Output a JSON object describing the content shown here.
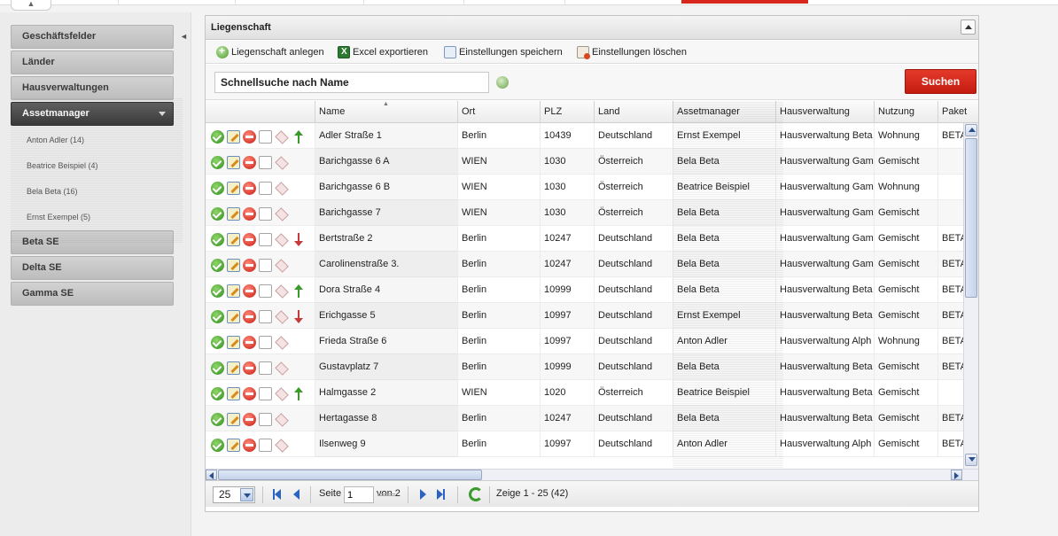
{
  "sidebar": {
    "items": [
      {
        "label": "Geschäftsfelder"
      },
      {
        "label": "Länder"
      },
      {
        "label": "Hausverwaltungen"
      },
      {
        "label": "Assetmanager"
      },
      {
        "label": "Beta SE"
      },
      {
        "label": "Delta SE"
      },
      {
        "label": "Gamma SE"
      }
    ],
    "subitems": [
      {
        "label": "Anton Adler (14)"
      },
      {
        "label": "Beatrice Beispiel (4)"
      },
      {
        "label": "Bela Beta (16)"
      },
      {
        "label": "Ernst Exempel (5)"
      }
    ]
  },
  "panel": {
    "title": "Liegenschaft"
  },
  "toolbar": {
    "add_label": "Liegenschaft anlegen",
    "excel_label": "Excel exportieren",
    "save_label": "Einstellungen speichern",
    "delete_label": "Einstellungen löschen"
  },
  "search": {
    "value": "Schnellsuche nach Name",
    "button": "Suchen"
  },
  "grid": {
    "columns": [
      "Name",
      "Ort",
      "PLZ",
      "Land",
      "Assetmanager",
      "Hausverwaltung",
      "Nutzung",
      "Paket"
    ],
    "rows": [
      {
        "name": "Adler Straße 1",
        "ort": "Berlin",
        "plz": "10439",
        "land": "Deutschland",
        "am": "Ernst Exempel",
        "hv": "Hausverwaltung Beta",
        "nutzung": "Wohnung",
        "paket": "BETA",
        "trend": "up"
      },
      {
        "name": "Barichgasse 6 A",
        "ort": "WIEN",
        "plz": "1030",
        "land": "Österreich",
        "am": "Bela Beta",
        "hv": "Hausverwaltung Gam",
        "nutzung": "Gemischt",
        "paket": "",
        "trend": ""
      },
      {
        "name": "Barichgasse 6 B",
        "ort": "WIEN",
        "plz": "1030",
        "land": "Österreich",
        "am": "Beatrice Beispiel",
        "hv": "Hausverwaltung Gam",
        "nutzung": "Wohnung",
        "paket": "",
        "trend": ""
      },
      {
        "name": "Barichgasse 7",
        "ort": "WIEN",
        "plz": "1030",
        "land": "Österreich",
        "am": "Bela Beta",
        "hv": "Hausverwaltung Gam",
        "nutzung": "Gemischt",
        "paket": "",
        "trend": ""
      },
      {
        "name": "Bertstraße 2",
        "ort": "Berlin",
        "plz": "10247",
        "land": "Deutschland",
        "am": "Bela Beta",
        "hv": "Hausverwaltung Gam",
        "nutzung": "Gemischt",
        "paket": "BETA",
        "trend": "down"
      },
      {
        "name": "Carolinenstraße 3.",
        "ort": "Berlin",
        "plz": "10247",
        "land": "Deutschland",
        "am": "Bela Beta",
        "hv": "Hausverwaltung Gam",
        "nutzung": "Gemischt",
        "paket": "BETA",
        "trend": ""
      },
      {
        "name": "Dora Straße 4",
        "ort": "Berlin",
        "plz": "10999",
        "land": "Deutschland",
        "am": "Bela Beta",
        "hv": "Hausverwaltung Beta",
        "nutzung": "Gemischt",
        "paket": "BETA",
        "trend": "up"
      },
      {
        "name": "Erichgasse 5",
        "ort": "Berlin",
        "plz": "10997",
        "land": "Deutschland",
        "am": "Ernst Exempel",
        "hv": "Hausverwaltung Beta",
        "nutzung": "Gemischt",
        "paket": "BETA",
        "trend": "down"
      },
      {
        "name": "Frieda Straße 6",
        "ort": "Berlin",
        "plz": "10997",
        "land": "Deutschland",
        "am": "Anton Adler",
        "hv": "Hausverwaltung Alph",
        "nutzung": "Wohnung",
        "paket": "BETA",
        "trend": ""
      },
      {
        "name": "Gustavplatz 7",
        "ort": "Berlin",
        "plz": "10999",
        "land": "Deutschland",
        "am": "Bela Beta",
        "hv": "Hausverwaltung Beta",
        "nutzung": "Gemischt",
        "paket": "BETA",
        "trend": ""
      },
      {
        "name": "Halmgasse 2",
        "ort": "WIEN",
        "plz": "1020",
        "land": "Österreich",
        "am": "Beatrice Beispiel",
        "hv": "Hausverwaltung Beta",
        "nutzung": "Gemischt",
        "paket": "",
        "trend": "up"
      },
      {
        "name": "Hertagasse 8",
        "ort": "Berlin",
        "plz": "10247",
        "land": "Deutschland",
        "am": "Bela Beta",
        "hv": "Hausverwaltung Beta",
        "nutzung": "Gemischt",
        "paket": "BETA",
        "trend": ""
      },
      {
        "name": "Ilsenweg 9",
        "ort": "Berlin",
        "plz": "10997",
        "land": "Deutschland",
        "am": "Anton Adler",
        "hv": "Hausverwaltung Alph",
        "nutzung": "Gemischt",
        "paket": "BETA",
        "trend": ""
      }
    ]
  },
  "paging": {
    "page_size": "25",
    "page_label": "Seite",
    "page_value": "1",
    "of_label": "von 2",
    "display_info": "Zeige 1 - 25 (42)"
  },
  "icons": {
    "row_actions": [
      "ok-icon",
      "edit-icon",
      "delete-icon",
      "copy-icon",
      "tag-icon"
    ],
    "trend_up": "arrow-up-icon",
    "trend_down": "arrow-down-icon"
  },
  "colors": {
    "accent": "#d9261c",
    "active_nav": "#3b3b3b"
  }
}
